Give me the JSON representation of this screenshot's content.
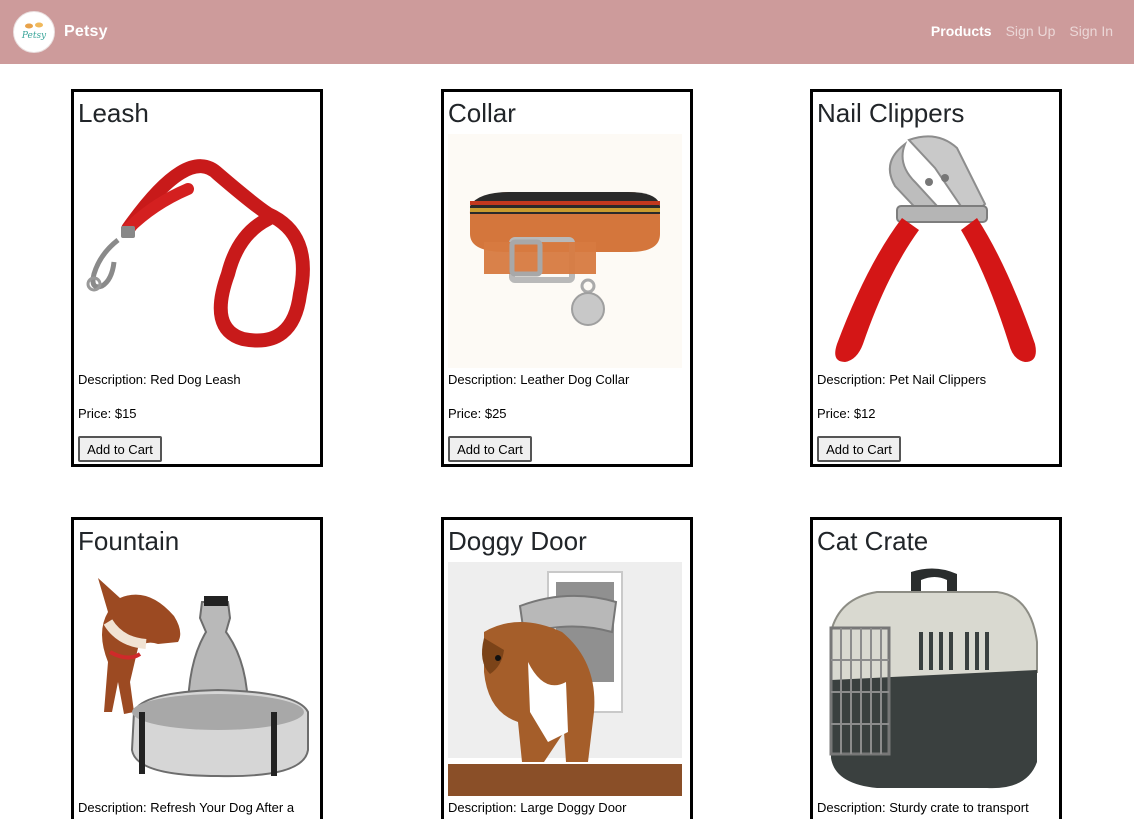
{
  "navbar": {
    "brand": "Petsy",
    "logo_text": "Petsy",
    "links": [
      {
        "label": "Products",
        "active": true
      },
      {
        "label": "Sign Up",
        "active": false
      },
      {
        "label": "Sign In",
        "active": false
      }
    ]
  },
  "products": [
    {
      "title": "Leash",
      "image_icon": "red-leash-image",
      "description": "Description: Red Dog Leash",
      "price": "Price: $15",
      "button": "Add to Cart"
    },
    {
      "title": "Collar",
      "image_icon": "leather-collar-image",
      "description": "Description: Leather Dog Collar",
      "price": "Price: $25",
      "button": "Add to Cart"
    },
    {
      "title": "Nail Clippers",
      "image_icon": "nail-clippers-image",
      "description": "Description: Pet Nail Clippers",
      "price": "Price: $12",
      "button": "Add to Cart"
    },
    {
      "title": "Fountain",
      "image_icon": "water-fountain-image",
      "description": "Description: Refresh Your Dog After a",
      "price": "",
      "button": ""
    },
    {
      "title": "Doggy Door",
      "image_icon": "doggy-door-image",
      "description": "Description: Large Doggy Door",
      "price": "",
      "button": ""
    },
    {
      "title": "Cat Crate",
      "image_icon": "cat-crate-image",
      "description": "Description: Sturdy crate to transport",
      "price": "",
      "button": ""
    }
  ],
  "colors": {
    "navbar_bg": "#cd9b9b",
    "card_border": "#000000"
  }
}
